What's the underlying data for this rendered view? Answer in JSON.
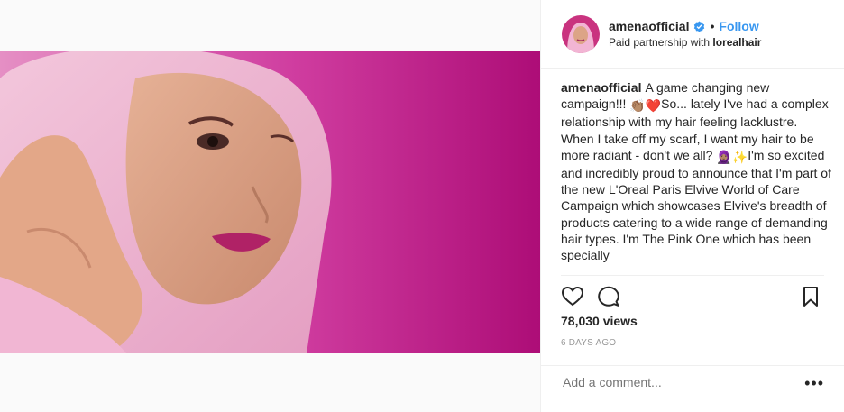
{
  "header": {
    "username": "amenaofficial",
    "follow_label": "Follow",
    "separator": "•",
    "partnership_prefix": "Paid partnership with",
    "partner_name": "lorealhair"
  },
  "caption": {
    "username": "amenaofficial",
    "part1": "A game changing new campaign!!! ",
    "emoji1": "👏🏽❤️",
    "part2": "So... lately I've had a complex relationship with my hair feeling lacklustre. When I take off my scarf, I want my hair to be more radiant - don't we all? ",
    "emoji2": "🧕🏽✨",
    "part3": "I'm so excited and incredibly proud to announce that I'm part of the new L'Oreal Paris Elvive World of Care Campaign which showcases Elvive's breadth of products catering to a wide range of demanding hair types. I'm The Pink One which has been specially"
  },
  "stats": {
    "views": "78,030 views",
    "time_ago": "6 DAYS AGO"
  },
  "comment": {
    "placeholder": "Add a comment...",
    "more_label": "•••"
  },
  "icons": [
    "heart-icon",
    "comment-icon",
    "bookmark-icon",
    "verified-badge-icon"
  ],
  "colors": {
    "link": "#3897f0",
    "verified": "#3897f0",
    "photo_background": "#b3127e"
  }
}
